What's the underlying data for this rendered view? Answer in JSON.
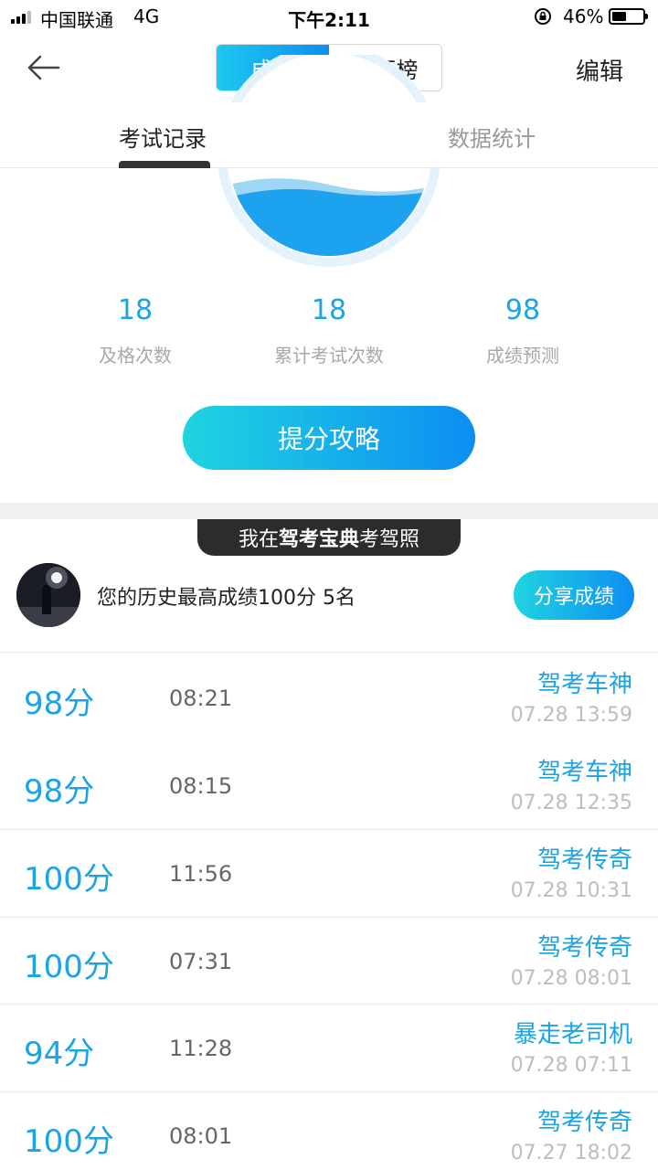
{
  "status_bar": {
    "carrier": "中国联通",
    "network": "4G",
    "time": "下午2:11",
    "battery_text": "46%",
    "battery_level": 0.46
  },
  "nav": {
    "seg_tabs": [
      {
        "label": "成绩",
        "active": true
      },
      {
        "label": "排行榜",
        "active": false
      }
    ],
    "edit_label": "编辑"
  },
  "sub_tabs": [
    {
      "label": "考试记录",
      "active": true
    },
    {
      "label": "数据统计",
      "active": false
    }
  ],
  "stats": [
    {
      "value": "18",
      "label": "及格次数"
    },
    {
      "value": "18",
      "label": "累计考试次数"
    },
    {
      "value": "98",
      "label": "成绩预测"
    }
  ],
  "tips_button": "提分攻略",
  "banner": {
    "prefix": "我在",
    "brand": "驾考宝典",
    "suffix": "考驾照"
  },
  "best": {
    "text": "您的历史最高成绩100分 5名",
    "share_label": "分享成绩"
  },
  "records": [
    {
      "score": "98分",
      "duration": "08:21",
      "title": "驾考车神",
      "time": "07.28 13:59"
    },
    {
      "score": "98分",
      "duration": "08:15",
      "title": "驾考车神",
      "time": "07.28 12:35"
    },
    {
      "score": "100分",
      "duration": "11:56",
      "title": "驾考传奇",
      "time": "07.28 10:31"
    },
    {
      "score": "100分",
      "duration": "07:31",
      "title": "驾考传奇",
      "time": "07.28 08:01"
    },
    {
      "score": "94分",
      "duration": "11:28",
      "title": "暴走老司机",
      "time": "07.28 07:11"
    },
    {
      "score": "100分",
      "duration": "08:01",
      "title": "驾考传奇",
      "time": "07.27 18:02"
    }
  ],
  "colors": {
    "accent": "#1aa4e6",
    "gradient_start": "#1fd4e0",
    "gradient_end": "#0d8ef2",
    "muted": "#a8a8a8"
  },
  "icons": {
    "back": "arrow-left-icon",
    "lock": "orientation-lock-icon",
    "battery": "battery-icon",
    "signal": "signal-icon"
  }
}
